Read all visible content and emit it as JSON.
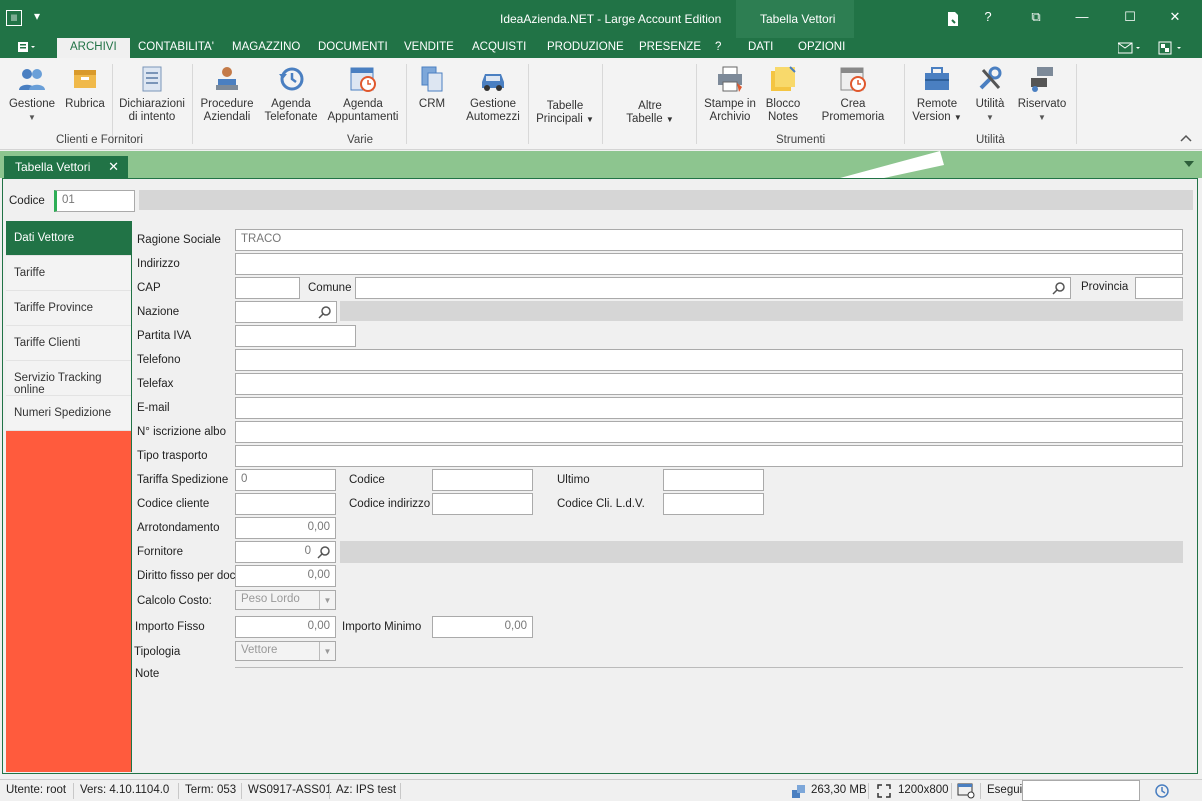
{
  "window": {
    "title": "IdeaAzienda.NET - Large Account Edition",
    "context_tab": "Tabella Vettori",
    "buttons": {
      "help": "?",
      "restore": "⧉",
      "minimize": "—",
      "maximize": "☐",
      "close": "✕"
    }
  },
  "menu": {
    "tabs": [
      "ARCHIVI",
      "CONTABILITA'",
      "MAGAZZINO",
      "DOCUMENTI",
      "VENDITE",
      "ACQUISTI",
      "PRODUZIONE",
      "PRESENZE",
      "?",
      "DATI",
      "OPZIONI"
    ]
  },
  "ribbon": {
    "gestione": "Gestione",
    "rubrica": "Rubrica",
    "dichiarazioni": [
      "Dichiarazioni",
      "di intento"
    ],
    "procedure": [
      "Procedure",
      "Aziendali"
    ],
    "agenda_tel": [
      "Agenda",
      "Telefonate"
    ],
    "agenda_app": [
      "Agenda",
      "Appuntamenti"
    ],
    "crm": "CRM",
    "automezzi": [
      "Gestione",
      "Automezzi"
    ],
    "tabelle_principali": [
      "Tabelle",
      "Principali"
    ],
    "altre_tabelle": [
      "Altre",
      "Tabelle"
    ],
    "stampe": [
      "Stampe in",
      "Archivio"
    ],
    "blocco": [
      "Blocco",
      "Notes"
    ],
    "promemoria": "Crea Promemoria",
    "remote": [
      "Remote",
      "Version"
    ],
    "utilita": "Utilità",
    "riservato": "Riservato",
    "groups": {
      "clienti": "Clienti e Fornitori",
      "varie": "Varie",
      "strumenti": "Strumenti",
      "utilita": "Utilità"
    }
  },
  "doc_tab": {
    "label": "Tabella Vettori",
    "close": "✕"
  },
  "codice": {
    "label": "Codice",
    "value": "01"
  },
  "sidenav": [
    "Dati Vettore",
    "Tariffe",
    "Tariffe Province",
    "Tariffe Clienti",
    "Servizio Tracking online",
    "Numeri Spedizione"
  ],
  "form": {
    "ragione_sociale": {
      "label": "Ragione Sociale",
      "value": "TRACO"
    },
    "indirizzo": {
      "label": "Indirizzo",
      "value": ""
    },
    "cap": {
      "label": "CAP",
      "value": ""
    },
    "comune": {
      "label": "Comune",
      "value": ""
    },
    "provincia": {
      "label": "Provincia",
      "value": ""
    },
    "nazione": {
      "label": "Nazione",
      "value": ""
    },
    "partita_iva": {
      "label": "Partita IVA",
      "value": ""
    },
    "telefono": {
      "label": "Telefono",
      "value": ""
    },
    "telefax": {
      "label": "Telefax",
      "value": ""
    },
    "email": {
      "label": "E-mail",
      "value": ""
    },
    "iscrizione_albo": {
      "label": "N° iscrizione albo",
      "value": ""
    },
    "tipo_trasporto": {
      "label": "Tipo trasporto",
      "value": ""
    },
    "tariffa_spedizione": {
      "label": "Tariffa Spedizione",
      "value": "0"
    },
    "codice2": {
      "label": "Codice",
      "value": ""
    },
    "ultimo": {
      "label": "Ultimo",
      "value": ""
    },
    "codice_cliente": {
      "label": "Codice cliente",
      "value": ""
    },
    "codice_indirizzo": {
      "label": "Codice indirizzo",
      "value": ""
    },
    "codice_cli_ldv": {
      "label": "Codice Cli. L.d.V.",
      "value": ""
    },
    "arrotondamento": {
      "label": "Arrotondamento",
      "value": "0,00"
    },
    "fornitore": {
      "label": "Fornitore",
      "value": "0"
    },
    "diritto_fisso": {
      "label": "Diritto fisso per doc.",
      "value": "0,00"
    },
    "calcolo_costo": {
      "label": "Calcolo Costo:",
      "value": "Peso Lordo"
    },
    "importo_fisso": {
      "label": "Importo Fisso",
      "value": "0,00"
    },
    "importo_minimo": {
      "label": "Importo Minimo",
      "value": "0,00"
    },
    "tipologia": {
      "label": "Tipologia",
      "value": "Vettore"
    },
    "note": {
      "label": "Note"
    }
  },
  "status": {
    "utente": "Utente: root",
    "versione": "Vers: 4.10.1104.0",
    "term": "Term: 053",
    "workstation": "WS0917-ASS01",
    "azienda": "Az: IPS test",
    "memoria": "263,30 MB",
    "risoluzione": "1200x800",
    "esegui": "Esegui"
  }
}
